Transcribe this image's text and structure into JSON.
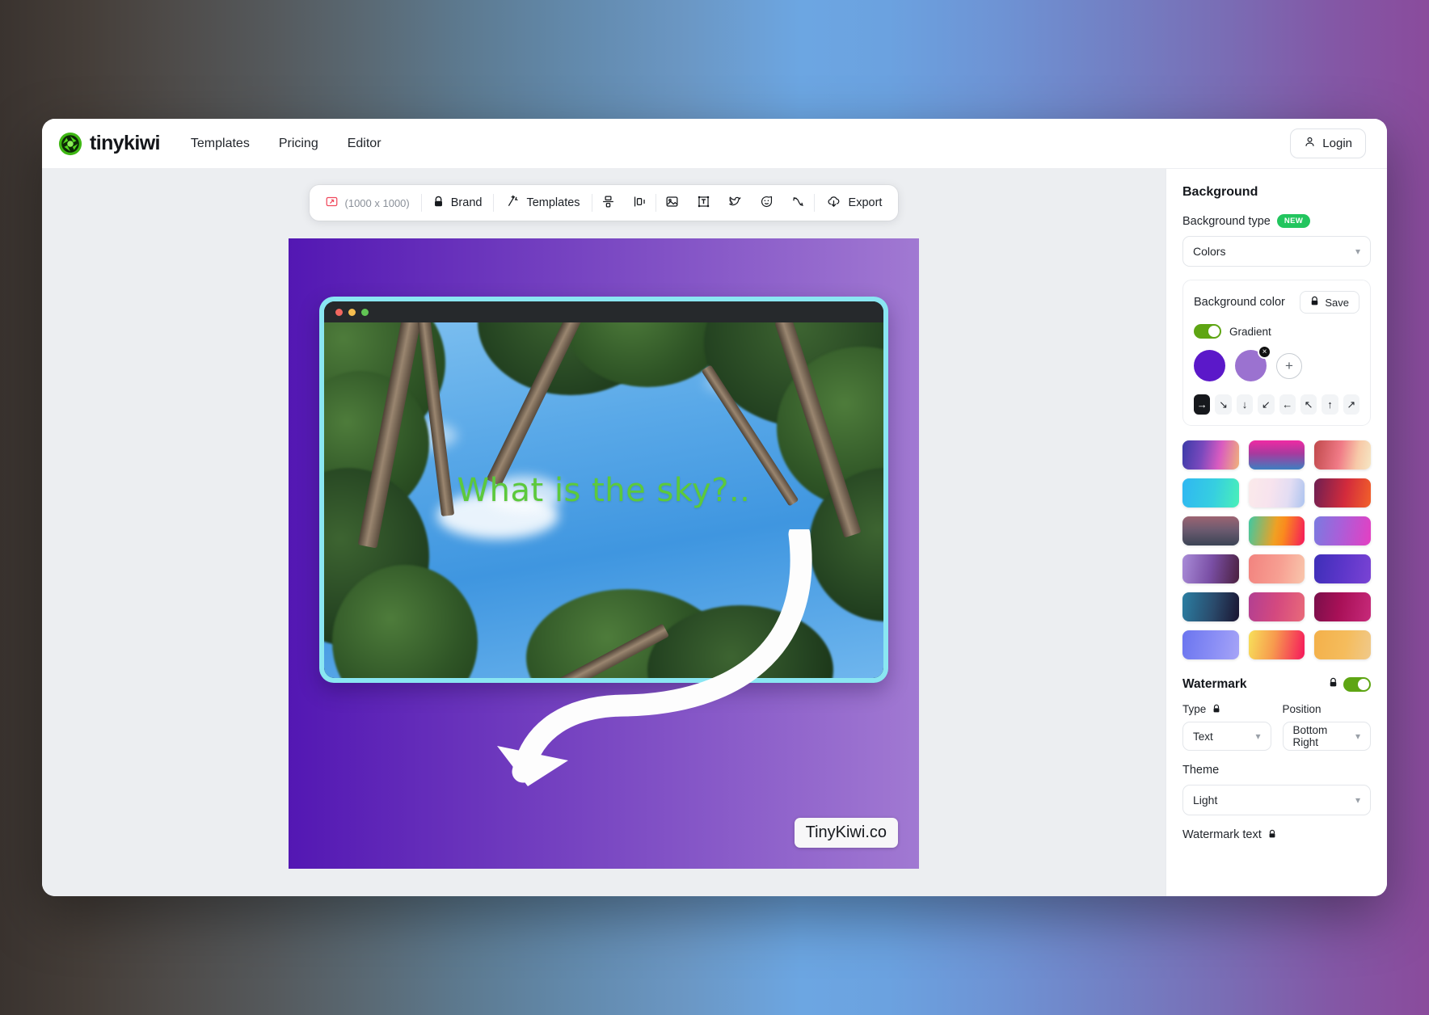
{
  "topnav": {
    "brand_name": "tinykiwi",
    "links": [
      {
        "label": "Templates"
      },
      {
        "label": "Pricing"
      },
      {
        "label": "Editor"
      }
    ],
    "login_label": "Login"
  },
  "toolbar": {
    "size_label": "(1000 x 1000)",
    "brand_label": "Brand",
    "templates_label": "Templates",
    "export_label": "Export",
    "icon_names": [
      "resize-icon",
      "lock-icon",
      "magic-wand-icon",
      "align-vertical-icon",
      "align-horizontal-icon",
      "image-icon",
      "text-icon",
      "twitter-icon",
      "emoji-icon",
      "arrow-curve-icon",
      "cloud-download-icon"
    ]
  },
  "canvas": {
    "overlay_text": "What is the sky?..",
    "watermark_badge": "TinyKiwi.co",
    "gradient_from": "#5317b3",
    "gradient_to": "#a179d2",
    "frame_color": "#8ae6f2",
    "overlay_text_color": "#5cc93c"
  },
  "panel": {
    "title": "Background",
    "background_type_label": "Background type",
    "new_badge": "NEW",
    "background_type_value": "Colors",
    "background_color": {
      "title": "Background color",
      "save_label": "Save",
      "gradient_label": "Gradient",
      "gradient_on": true,
      "swatches": [
        "#5b18c9",
        "#9b72d0"
      ],
      "add_label": "+",
      "remove_label": "×",
      "directions": [
        {
          "name": "right",
          "glyph": "→",
          "active": true
        },
        {
          "name": "down-right",
          "glyph": "↘",
          "active": false
        },
        {
          "name": "down",
          "glyph": "↓",
          "active": false
        },
        {
          "name": "down-left",
          "glyph": "↙",
          "active": false
        },
        {
          "name": "left",
          "glyph": "←",
          "active": false
        },
        {
          "name": "up-left",
          "glyph": "↖",
          "active": false
        },
        {
          "name": "up",
          "glyph": "↑",
          "active": false
        },
        {
          "name": "up-right",
          "glyph": "↗",
          "active": false
        }
      ]
    },
    "gradient_presets": [
      "linear-gradient(100deg,#3b3ba8 0%,#7a49bd 35%,#d95bc0 65%,#f0b37a 100%)",
      "linear-gradient(180deg,#ef2aa3 0%,#a83a9e 45%,#3d7fc0 100%)",
      "linear-gradient(100deg,#c0494c 0%,#f07a86 45%,#f7c9a8 75%,#f6e7c4 100%)",
      "linear-gradient(100deg,#2fb7f2 0%,#36cfe0 55%,#4af0b8 100%)",
      "linear-gradient(100deg,#fbeaea 0%,#f7e3ee 40%,#e3ddf3 70%,#adc4ef 100%)",
      "linear-gradient(100deg,#6e1f52 0%,#d32b3c 55%,#f2612a 100%)",
      "linear-gradient(180deg,#9c6472 0%,#6d5b70 45%,#3b4455 100%)",
      "linear-gradient(100deg,#3ec9a3 0%,#f0a023 48%,#fa8a1e 62%,#f5175c 100%)",
      "linear-gradient(100deg,#7a7be0 0%,#a95fd9 45%,#e53fc2 100%)",
      "linear-gradient(100deg,#a98cd8 0%,#7a4fa5 50%,#4a1f3e 100%)",
      "linear-gradient(100deg,#f2837f 0%,#f79f92 55%,#f9c6ac 100%)",
      "linear-gradient(100deg,#3d2fb8 0%,#5c36c9 50%,#7a43d4 100%)",
      "linear-gradient(100deg,#2b7fa3 0%,#2a4a6b 55%,#1a1430 100%)",
      "linear-gradient(100deg,#b23f92 0%,#d4497f 50%,#e96a7a 100%)",
      "linear-gradient(100deg,#7a0f4a 0%,#a81057 45%,#c72a7a 100%)",
      "linear-gradient(100deg,#6b75ef 0%,#8a8ef5 55%,#a6a4f7 100%)",
      "linear-gradient(100deg,#f7e05a 0%,#f79a4e 45%,#f5175c 100%)",
      "linear-gradient(100deg,#f3b04a 0%,#f5bc5c 55%,#f0c98a 100%)"
    ],
    "watermark": {
      "title": "Watermark",
      "enabled": true,
      "type_label": "Type",
      "type_value": "Text",
      "position_label": "Position",
      "position_value": "Bottom Right",
      "theme_label": "Theme",
      "theme_value": "Light",
      "watermark_text_label": "Watermark text"
    }
  }
}
